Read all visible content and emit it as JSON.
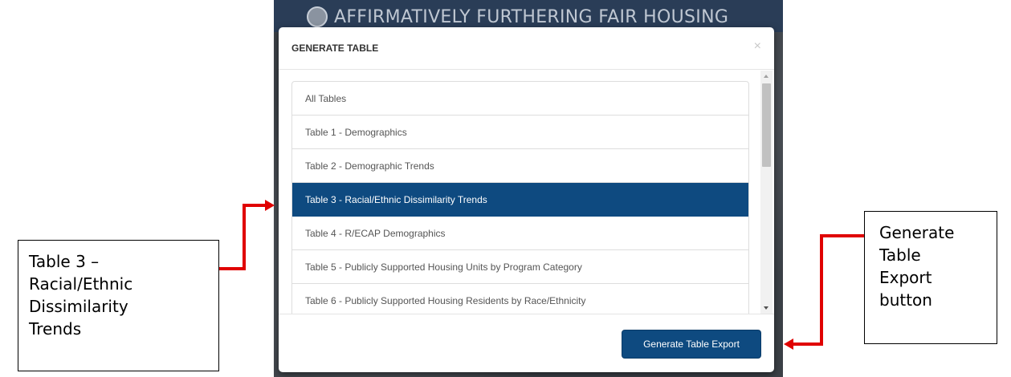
{
  "app": {
    "title": "AFFIRMATIVELY FURTHERING FAIR HOUSING"
  },
  "modal": {
    "title": "GENERATE TABLE",
    "close_label": "×",
    "items": [
      {
        "label": "All Tables",
        "selected": false
      },
      {
        "label": "Table 1 - Demographics",
        "selected": false
      },
      {
        "label": "Table 2 - Demographic Trends",
        "selected": false
      },
      {
        "label": "Table 3 - Racial/Ethnic Dissimilarity Trends",
        "selected": true
      },
      {
        "label": "Table 4 - R/ECAP Demographics",
        "selected": false
      },
      {
        "label": "Table 5 - Publicly Supported Housing Units by Program Category",
        "selected": false
      },
      {
        "label": "Table 6 - Publicly Supported Housing Residents by Race/Ethnicity",
        "selected": false
      }
    ],
    "export_button_label": "Generate Table Export"
  },
  "annotations": {
    "left_callout": "Table 3 –\nRacial/Ethnic\nDissimilarity\nTrends",
    "right_callout": "Generate\nTable\nExport\nbutton",
    "arrow_color": "#e00000"
  },
  "colors": {
    "accent": "#0e4a80",
    "header_bg": "#2a3d57"
  }
}
